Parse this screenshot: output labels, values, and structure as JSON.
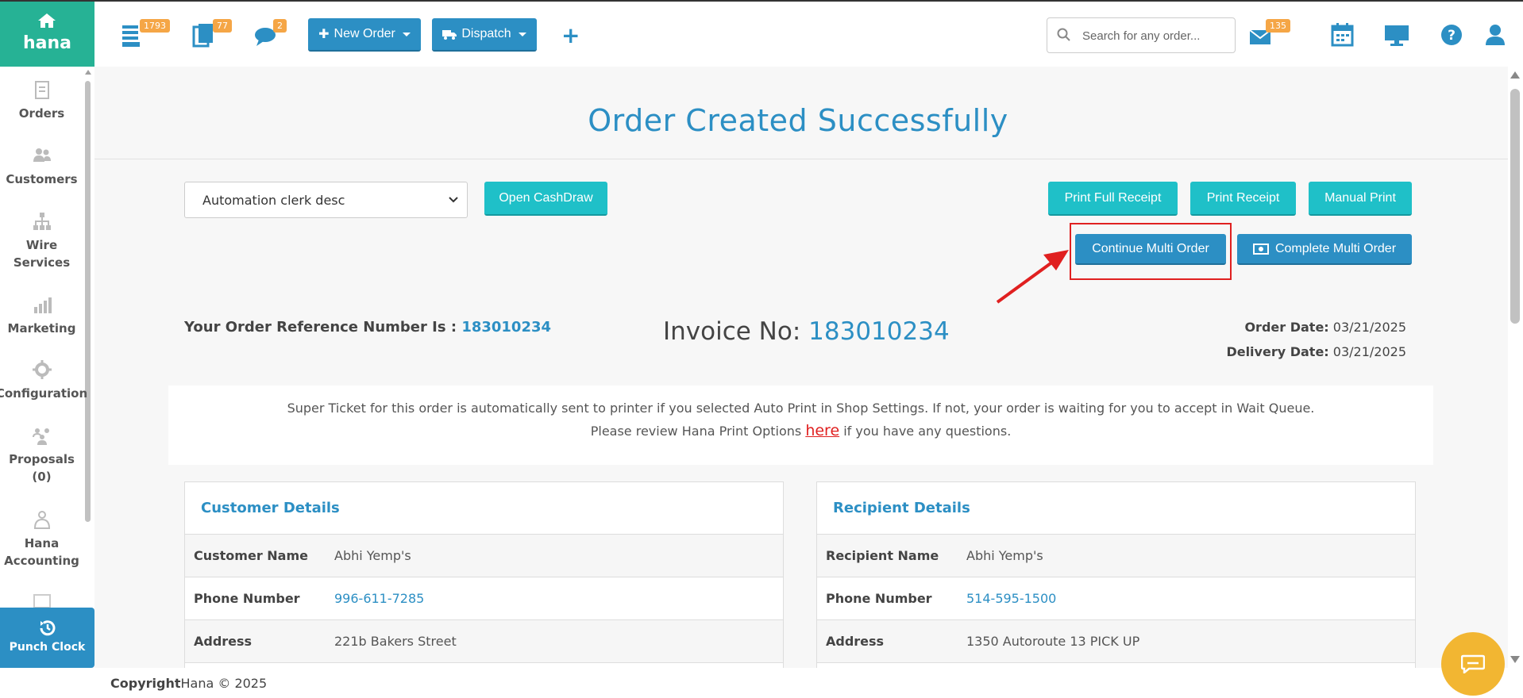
{
  "app": {
    "logo_text": "hana"
  },
  "topbar": {
    "badges": {
      "orders": "1793",
      "copies": "77",
      "messages": "2",
      "mail": "135"
    },
    "new_order_label": "New Order",
    "dispatch_label": "Dispatch",
    "plus_label": "+",
    "search_placeholder": "Search for any order..."
  },
  "sidebar": {
    "items": [
      {
        "label": "Orders"
      },
      {
        "label": "Customers"
      },
      {
        "label": "Wire Services"
      },
      {
        "label": "Marketing"
      },
      {
        "label": "Configuration"
      },
      {
        "label": "Proposals (0)"
      },
      {
        "label": "Hana Accounting"
      }
    ],
    "punch_clock_label": "Punch Clock"
  },
  "main": {
    "title": "Order Created Successfully",
    "clerk_select_value": "Automation clerk desc",
    "open_cashdraw_label": "Open CashDraw",
    "print_full_receipt_label": "Print Full Receipt",
    "print_receipt_label": "Print Receipt",
    "manual_print_label": "Manual Print",
    "continue_multi_order_label": "Continue Multi Order",
    "complete_multi_order_label": "Complete Multi Order",
    "reference_label": "Your Order Reference Number Is :",
    "reference_number": "183010234",
    "invoice_label": "Invoice No:",
    "invoice_number": "183010234",
    "order_date_label": "Order Date:",
    "order_date": "03/21/2025",
    "delivery_date_label": "Delivery Date:",
    "delivery_date": "03/21/2025",
    "notice_line1": "Super Ticket for this order is automatically sent to printer if you selected Auto Print in Shop Settings. If not, your order is waiting for you to accept in Wait Queue.",
    "notice_line2_prefix": "Please review Hana Print Options",
    "notice_link": "here",
    "notice_line2_suffix": "if you have any questions."
  },
  "customer": {
    "heading": "Customer Details",
    "rows": [
      {
        "key": "Customer Name",
        "value": "Abhi Yemp's"
      },
      {
        "key": "Phone Number",
        "value": "996-611-7285"
      },
      {
        "key": "Address",
        "value": "221b Bakers Street"
      }
    ]
  },
  "recipient": {
    "heading": "Recipient Details",
    "rows": [
      {
        "key": "Recipient Name",
        "value": "Abhi Yemp's"
      },
      {
        "key": "Phone Number",
        "value": "514-595-1500"
      },
      {
        "key": "Address",
        "value": "1350 Autoroute 13 PICK UP"
      }
    ]
  },
  "footer": {
    "copyright_label": "Copyright",
    "copyright_text": "Hana © 2025"
  },
  "colors": {
    "brand_green": "#26b295",
    "primary_blue": "#2c8fc4",
    "teal": "#1fc0c8",
    "badge_orange": "#f5a646",
    "highlight_red": "#e02020",
    "chat_yellow": "#f2b632"
  }
}
